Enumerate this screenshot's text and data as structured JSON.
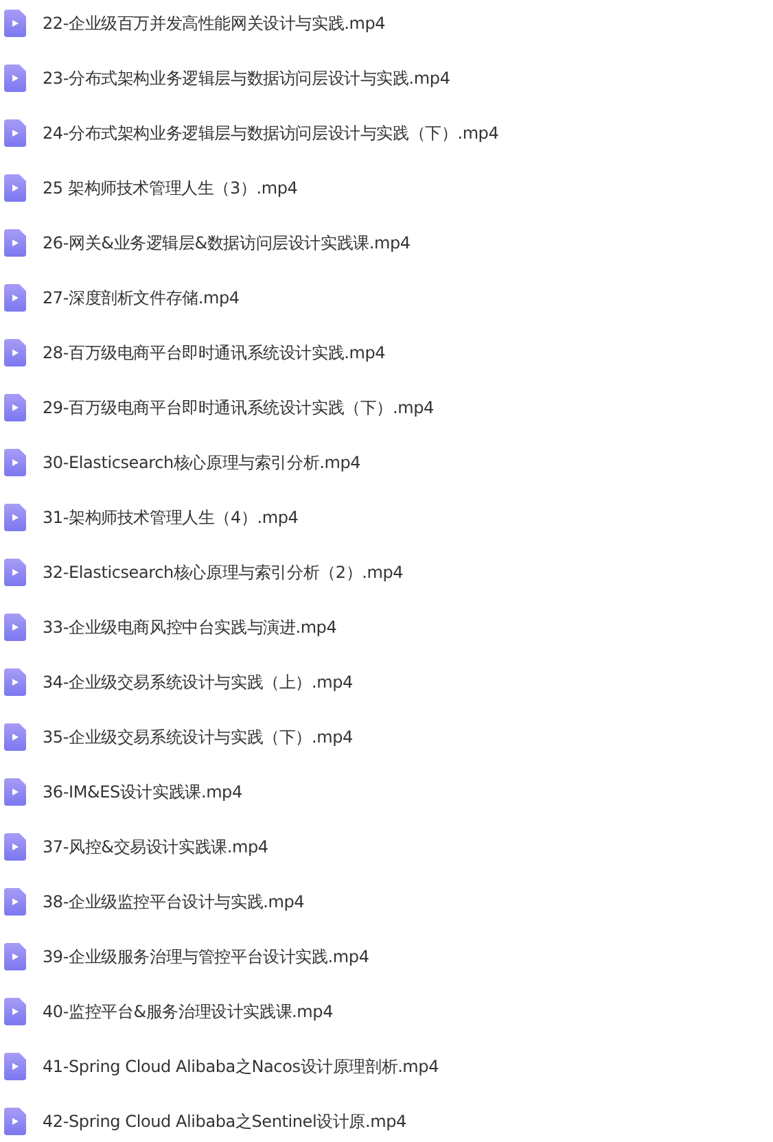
{
  "files": [
    {
      "name": "22-企业级百万并发高性能网关设计与实践.mp4"
    },
    {
      "name": "23-分布式架构业务逻辑层与数据访问层设计与实践.mp4"
    },
    {
      "name": "24-分布式架构业务逻辑层与数据访问层设计与实践（下）.mp4"
    },
    {
      "name": "25 架构师技术管理人生（3）.mp4"
    },
    {
      "name": "26-网关&业务逻辑层&数据访问层设计实践课.mp4"
    },
    {
      "name": "27-深度剖析文件存储.mp4"
    },
    {
      "name": "28-百万级电商平台即时通讯系统设计实践.mp4"
    },
    {
      "name": "29-百万级电商平台即时通讯系统设计实践（下）.mp4"
    },
    {
      "name": "30-Elasticsearch核心原理与索引分析.mp4"
    },
    {
      "name": "31-架构师技术管理人生（4）.mp4"
    },
    {
      "name": "32-Elasticsearch核心原理与索引分析（2）.mp4"
    },
    {
      "name": "33-企业级电商风控中台实践与演进.mp4"
    },
    {
      "name": "34-企业级交易系统设计与实践（上）.mp4"
    },
    {
      "name": "35-企业级交易系统设计与实践（下）.mp4"
    },
    {
      "name": "36-IM&ES设计实践课.mp4"
    },
    {
      "name": "37-风控&交易设计实践课.mp4"
    },
    {
      "name": "38-企业级监控平台设计与实践.mp4"
    },
    {
      "name": "39-企业级服务治理与管控平台设计实践.mp4"
    },
    {
      "name": "40-监控平台&服务治理设计实践课.mp4"
    },
    {
      "name": "41-Spring Cloud Alibaba之Nacos设计原理剖析.mp4"
    },
    {
      "name": "42-Spring Cloud Alibaba之Sentinel设计原.mp4"
    }
  ]
}
